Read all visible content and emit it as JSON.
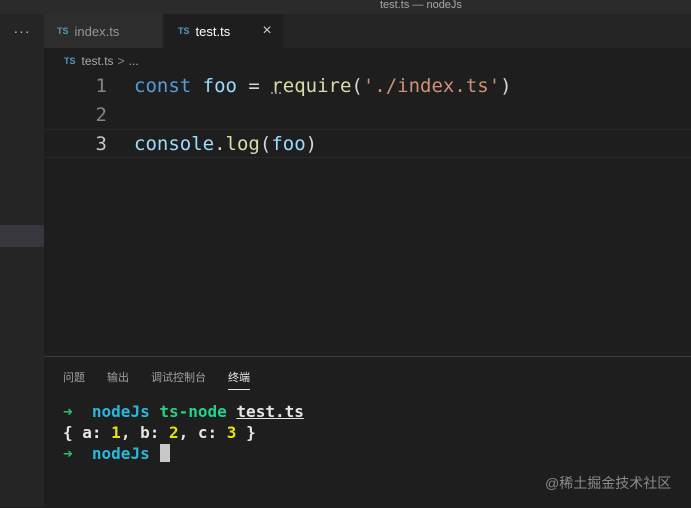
{
  "window": {
    "title": "test.ts — nodeJs"
  },
  "activity_bar": {
    "more_label": "···"
  },
  "tabs": [
    {
      "badge": "TS",
      "label": "index.ts"
    },
    {
      "badge": "TS",
      "label": "test.ts",
      "close": "×"
    }
  ],
  "breadcrumb": {
    "badge": "TS",
    "file": "test.ts",
    "separator": ">",
    "more": "..."
  },
  "editor": {
    "line_numbers": [
      "1",
      "2",
      "3"
    ],
    "line1": {
      "kw": "const",
      "var": "foo",
      "op": " = ",
      "fn_prefix": "r",
      "fn_rest": "equire",
      "open": "(",
      "str": "'./index.ts'",
      "close": ")"
    },
    "line3": {
      "obj": "console",
      "dot": ".",
      "fn": "log",
      "open": "(",
      "arg": "foo",
      "close": ")"
    }
  },
  "panel": {
    "tabs": [
      "问题",
      "输出",
      "调试控制台",
      "终端"
    ],
    "active_tab": "终端"
  },
  "terminal": {
    "arrow": "➜",
    "prompt_dir": "nodeJs",
    "command": "ts-node",
    "command_file": "test.ts",
    "output": {
      "open": "{ ",
      "a_key": "a: ",
      "a_val": "1",
      "sep1": ", ",
      "b_key": "b: ",
      "b_val": "2",
      "sep2": ", ",
      "c_key": "c: ",
      "c_val": "3",
      "close": " }"
    }
  },
  "watermark": "@稀土掘金技术社区",
  "colors": {
    "background": "#1e1e1e",
    "ts_badge": "#519aba",
    "keyword": "#569cd6",
    "function": "#dcdcaa",
    "string": "#ce9178",
    "terminal_arrow": "#2bc26a",
    "terminal_number": "#e5e510"
  }
}
